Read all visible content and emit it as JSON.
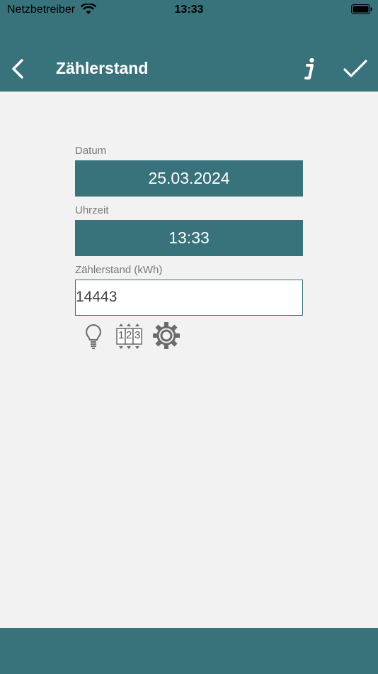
{
  "status_bar": {
    "carrier": "Netzbetreiber",
    "time": "13:33"
  },
  "nav": {
    "title": "Zählerstand",
    "back_icon": "chevron-left-icon",
    "info_icon": "info-icon",
    "confirm_icon": "checkmark-icon"
  },
  "form": {
    "date_label": "Datum",
    "date_value": "25.03.2024",
    "time_label": "Uhrzeit",
    "time_value": "13:33",
    "reading_label": "Zählerstand (kWh)",
    "reading_value": "14443"
  },
  "tools": {
    "bulb_icon": "lightbulb-icon",
    "counter_icon": "digit-counter-icon",
    "counter_digits": [
      "1",
      "2",
      "3"
    ],
    "settings_icon": "gear-icon"
  },
  "colors": {
    "primary": "#38727b",
    "background": "#f2f2f2",
    "label": "#7a7a7a"
  }
}
